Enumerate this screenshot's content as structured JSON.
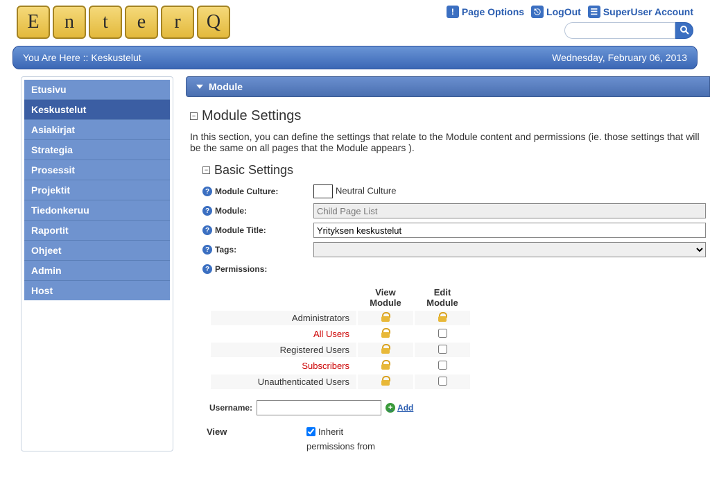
{
  "logo_letters": [
    "E",
    "n",
    "t",
    "e",
    "r",
    "Q"
  ],
  "toplinks": {
    "page_options": "Page Options",
    "logout": "LogOut",
    "account": "SuperUser Account"
  },
  "breadcrumb": {
    "prefix": "You Are Here ::",
    "location": "Keskustelut",
    "date": "Wednesday, February 06, 2013"
  },
  "sidebar": {
    "items": [
      "Etusivu",
      "Keskustelut",
      "Asiakirjat",
      "Strategia",
      "Prosessit",
      "Projektit",
      "Tiedonkeruu",
      "Raportit",
      "Ohjeet",
      "Admin",
      "Host"
    ],
    "active": "Keskustelut"
  },
  "module": {
    "header": "Module",
    "title": "Module Settings",
    "description": "In this section, you can define the settings that relate to the Module content and permissions (ie. those settings that will be the same on all pages that the Module appears ).",
    "basic_title": "Basic Settings",
    "labels": {
      "culture": "Module Culture:",
      "module": "Module:",
      "module_title": "Module Title:",
      "tags": "Tags:",
      "permissions": "Permissions:"
    },
    "values": {
      "culture_text": "Neutral Culture",
      "module_name": "Child Page List",
      "module_title_val": "Yrityksen keskustelut",
      "tags_val": ""
    },
    "perm": {
      "col_view": "View Module",
      "col_edit": "Edit Module",
      "rows": [
        {
          "role": "Administrators",
          "view": "lock",
          "edit": "lock",
          "red": false
        },
        {
          "role": "All Users",
          "view": "lock",
          "edit": "check",
          "red": true
        },
        {
          "role": "Registered Users",
          "view": "lock",
          "edit": "check",
          "red": false
        },
        {
          "role": "Subscribers",
          "view": "lock",
          "edit": "check",
          "red": true
        },
        {
          "role": "Unauthenticated Users",
          "view": "lock",
          "edit": "check",
          "red": false
        }
      ],
      "username_label": "Username:",
      "add": "Add",
      "view_label": "View",
      "inherit_label": "Inherit",
      "perm_from": "permissions from"
    }
  }
}
